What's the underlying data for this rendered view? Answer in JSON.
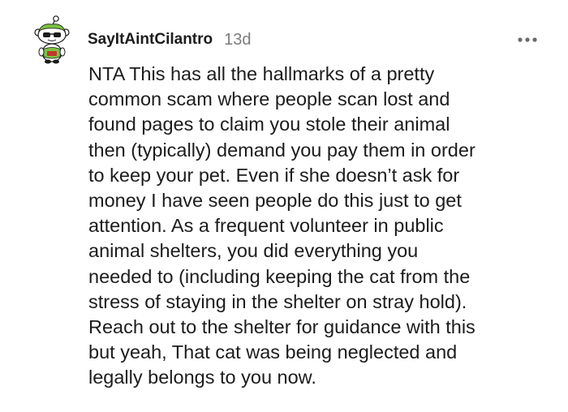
{
  "comment": {
    "author": "SayItAintCilantro",
    "age": "13d",
    "body": "NTA This has all the hallmarks of a pretty\ncommon scam where people scan lost and\nfound pages to claim you stole their animal\nthen (typically) demand you pay them in order\nto keep your pet. Even if she doesn’t ask for\nmoney I have seen people do this just to get\nattention. As a frequent volunteer in public\nanimal shelters, you did everything you\nneeded to (including keeping the cat from the\nstress of staying in the shelter on stray hold).\nReach out to the shelter for guidance with this\nbut yeah, That cat was being neglected and\nlegally belongs to you now.",
    "avatar_icon": "snoo-avatar-icon",
    "more_icon": "more-options-icon"
  },
  "colors": {
    "text": "#1c1c1c",
    "muted": "#7c7c7c",
    "avatar_green": "#7bc243",
    "avatar_red": "#c0392b"
  }
}
